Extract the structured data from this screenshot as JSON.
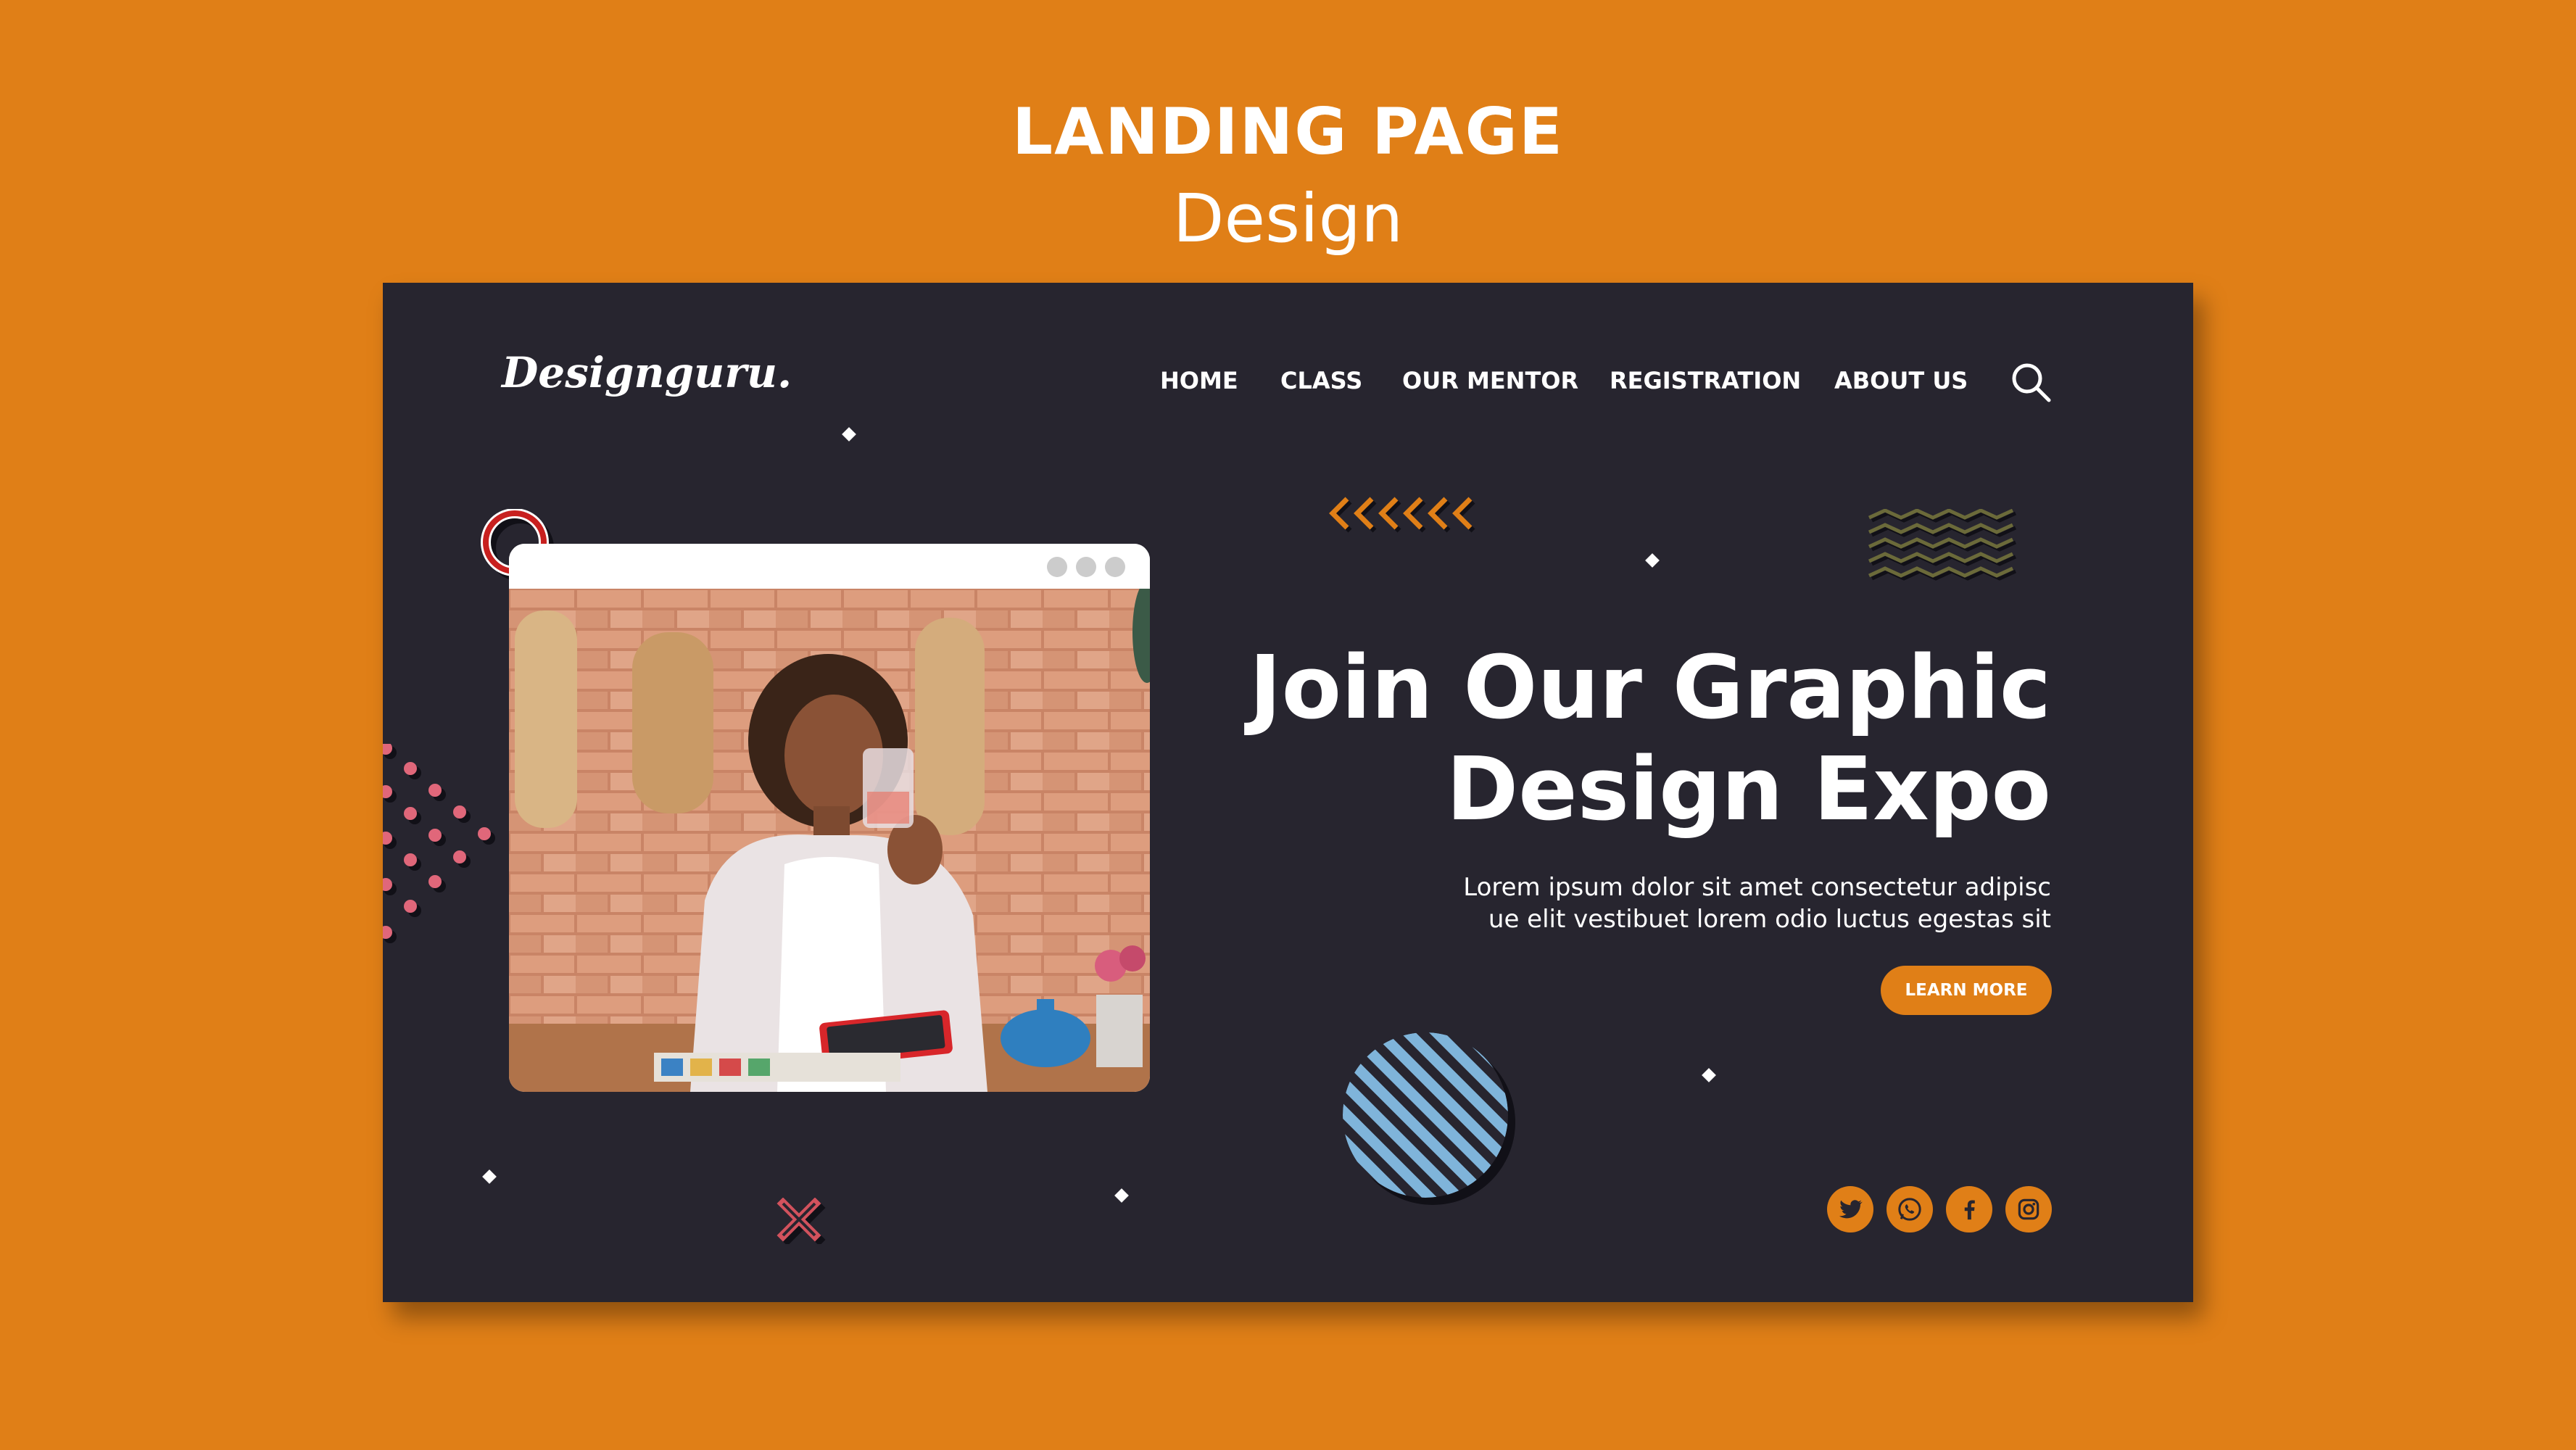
{
  "header": {
    "title": "LANDING PAGE",
    "subtitle": "Design"
  },
  "site": {
    "logo": "Designguru.",
    "nav": [
      {
        "label": "HOME"
      },
      {
        "label": "CLASS"
      },
      {
        "label": "OUR MENTOR"
      },
      {
        "label": "REGISTRATION"
      },
      {
        "label": "ABOUT US"
      }
    ],
    "search_icon": "search-icon"
  },
  "hero": {
    "headline_line1": "Join Our Graphic",
    "headline_line2": "Design Expo",
    "description_line1": "Lorem ipsum dolor sit amet consectetur adipisc",
    "description_line2": "ue elit vestibuet lorem odio luctus egestas sit",
    "cta_label": "LEARN MORE"
  },
  "social": [
    "twitter-icon",
    "whatsapp-icon",
    "facebook-icon",
    "instagram-icon"
  ],
  "colors": {
    "background": "#e07f17",
    "card": "#27252f",
    "accent": "#e07f17",
    "text": "#ffffff"
  }
}
